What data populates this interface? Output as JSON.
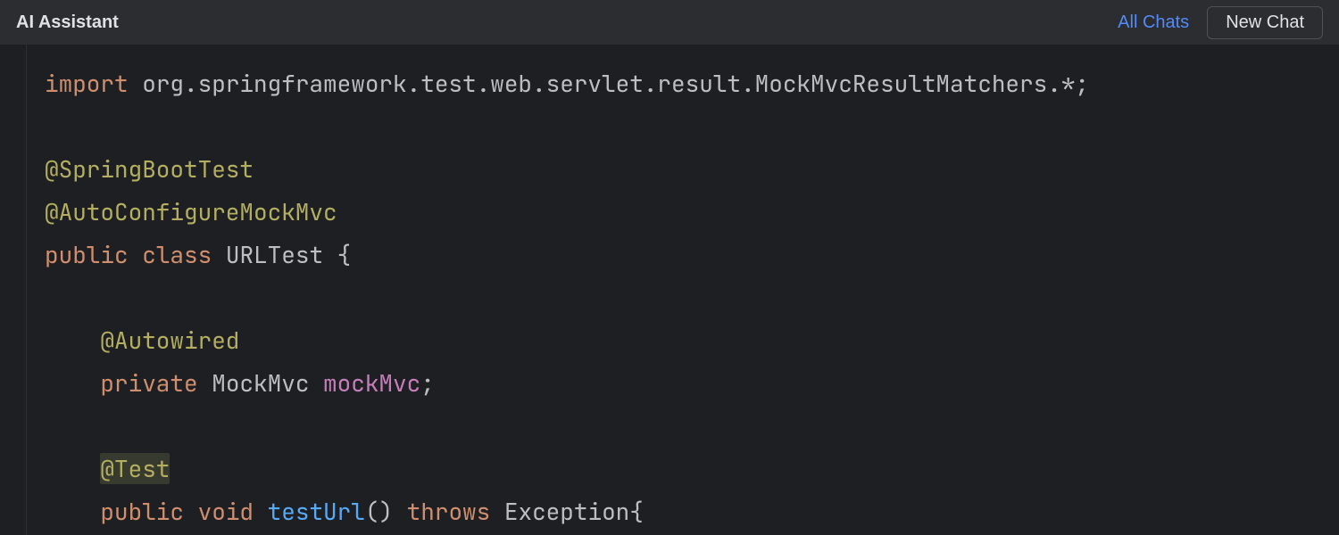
{
  "header": {
    "title": "AI Assistant",
    "all_chats": "All Chats",
    "new_chat": "New Chat"
  },
  "code": {
    "kw_import": "import",
    "import_pkg": "org.springframework.test.web.servlet.result.MockMvcResultMatchers.*",
    "semicolon": ";",
    "ann_springboottest": "@SpringBootTest",
    "ann_autoconfigure": "@AutoConfigureMockMvc",
    "kw_public": "public",
    "kw_class": "class",
    "class_name": "URLTest",
    "brace_open": "{",
    "ann_autowired": "@Autowired",
    "kw_private": "private",
    "type_mockmvc": "MockMvc",
    "field_mockmvc": "mockMvc",
    "ann_test": "@Test",
    "kw_void": "void",
    "method_testurl": "testUrl",
    "parens": "()",
    "kw_throws": "throws",
    "type_exception": "Exception",
    "brace_open2": "{",
    "indent1": "    ",
    "indent2": "        "
  }
}
